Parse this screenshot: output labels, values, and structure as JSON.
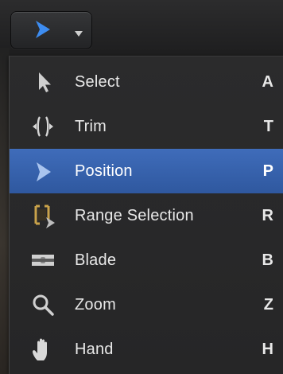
{
  "toolbar": {
    "tool_button_icon": "arrow-cursor-icon",
    "dropdown_icon": "chevron-down-icon"
  },
  "menu": {
    "items": [
      {
        "label": "Select",
        "shortcut": "A",
        "icon": "arrow-select-icon",
        "highlighted": false
      },
      {
        "label": "Trim",
        "shortcut": "T",
        "icon": "trim-icon",
        "highlighted": false
      },
      {
        "label": "Position",
        "shortcut": "P",
        "icon": "position-arrow-icon",
        "highlighted": true
      },
      {
        "label": "Range Selection",
        "shortcut": "R",
        "icon": "range-selection-icon",
        "highlighted": false
      },
      {
        "label": "Blade",
        "shortcut": "B",
        "icon": "blade-icon",
        "highlighted": false
      },
      {
        "label": "Zoom",
        "shortcut": "Z",
        "icon": "zoom-icon",
        "highlighted": false
      },
      {
        "label": "Hand",
        "shortcut": "H",
        "icon": "hand-icon",
        "highlighted": false
      }
    ]
  },
  "colors": {
    "highlight": "#3a66b3",
    "accent_blue": "#3d8cf0",
    "range_icon": "#c9a24a"
  }
}
